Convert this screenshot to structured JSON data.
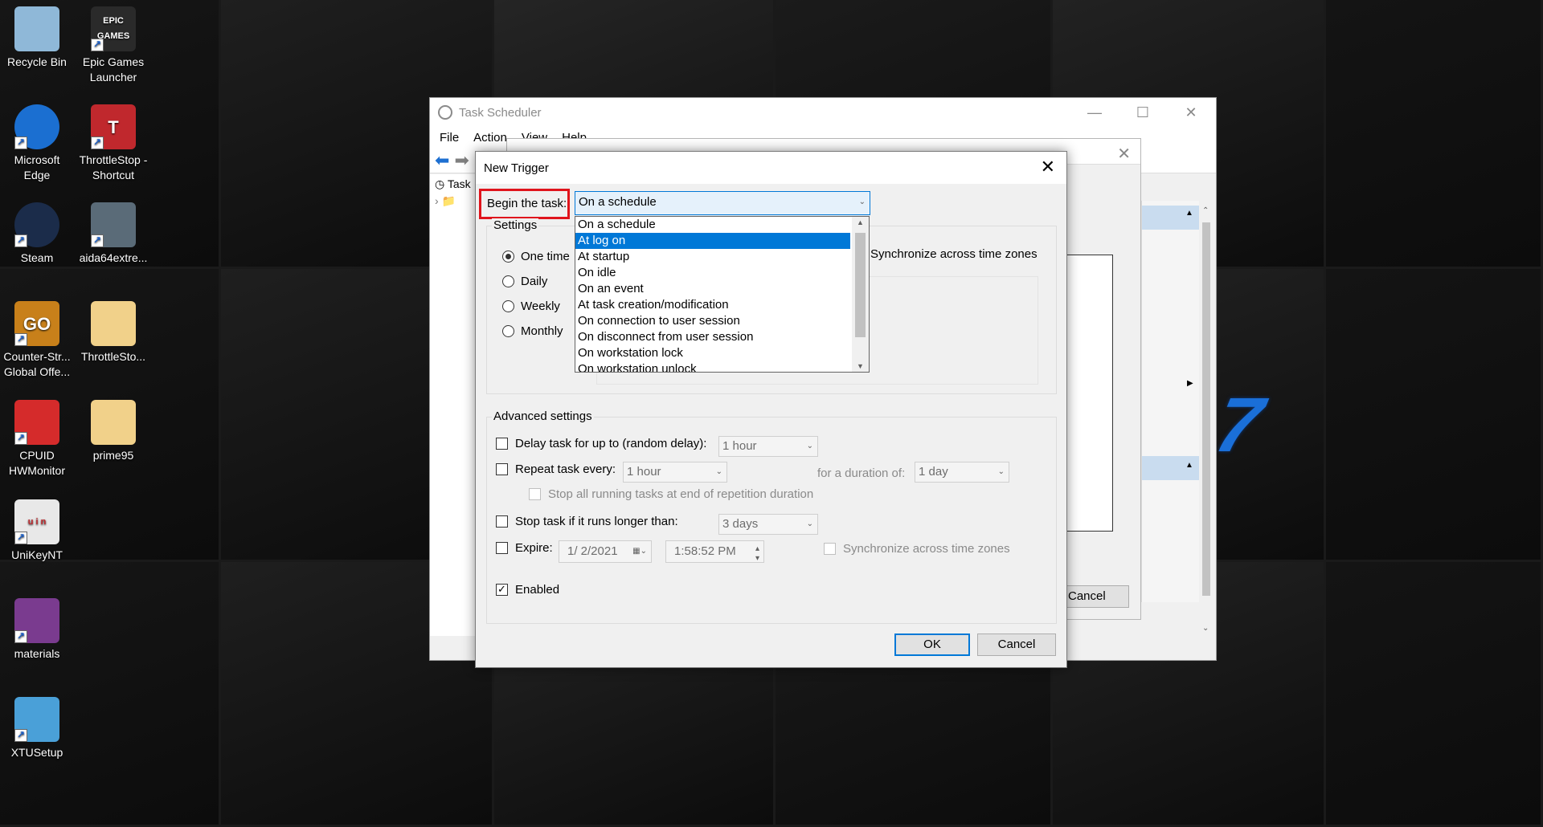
{
  "desktop_icons": [
    {
      "label": "Recycle Bin",
      "icon": "recycle-bin-icon"
    },
    {
      "label": "Epic Games Launcher",
      "icon": "epic-games-icon",
      "badge": "EPIC GAMES"
    },
    {
      "label": "Microsoft Edge",
      "icon": "edge-icon"
    },
    {
      "label": "ThrottleStop - Shortcut",
      "icon": "throttlestop-icon",
      "badge": "T"
    },
    {
      "label": "Steam",
      "icon": "steam-icon"
    },
    {
      "label": "aida64extre...",
      "icon": "aida64-icon"
    },
    {
      "label": "Counter-Str... Global Offe...",
      "icon": "csgo-icon",
      "badge": "GO"
    },
    {
      "label": "ThrottleSto...",
      "icon": "folder-icon"
    },
    {
      "label": "CPUID HWMonitor",
      "icon": "hwmonitor-icon"
    },
    {
      "label": "prime95",
      "icon": "folder-icon"
    },
    {
      "label": "UniKeyNT",
      "icon": "unikey-icon",
      "badge": "u i n"
    },
    {
      "label": "materials",
      "icon": "winrar-icon"
    },
    {
      "label": "XTUSetup",
      "icon": "xtu-icon"
    }
  ],
  "task_scheduler": {
    "title": "Task Scheduler",
    "menu": [
      "File",
      "Action",
      "View",
      "Help"
    ],
    "tree_item": "Task"
  },
  "create_task": {
    "cancel_label": "Cancel"
  },
  "new_trigger": {
    "title": "New Trigger",
    "begin_label": "Begin the task:",
    "begin_value": "On a schedule",
    "dropdown_options": [
      "On a schedule",
      "At log on",
      "At startup",
      "On idle",
      "On an event",
      "At task creation/modification",
      "On connection to user session",
      "On disconnect from user session",
      "On workstation lock",
      "On workstation unlock"
    ],
    "dropdown_selected_index": 1,
    "settings_label": "Settings",
    "schedule_options": [
      "One time",
      "Daily",
      "Weekly",
      "Monthly"
    ],
    "schedule_selected": "One time",
    "sync_label": "Synchronize across time zones",
    "advanced_label": "Advanced settings",
    "delay_label": "Delay task for up to (random delay):",
    "delay_value": "1 hour",
    "repeat_label": "Repeat task every:",
    "repeat_value": "1 hour",
    "duration_label": "for a duration of:",
    "duration_value": "1 day",
    "stop_running_label": "Stop all running tasks at end of repetition duration",
    "stop_longer_label": "Stop task if it runs longer than:",
    "stop_longer_value": "3 days",
    "expire_label": "Expire:",
    "expire_date": "1/ 2/2021",
    "expire_time": "1:58:52 PM",
    "expire_sync_label": "Synchronize across time zones",
    "enabled_label": "Enabled",
    "enabled_checked": true,
    "ok_label": "OK",
    "cancel_label": "Cancel"
  }
}
